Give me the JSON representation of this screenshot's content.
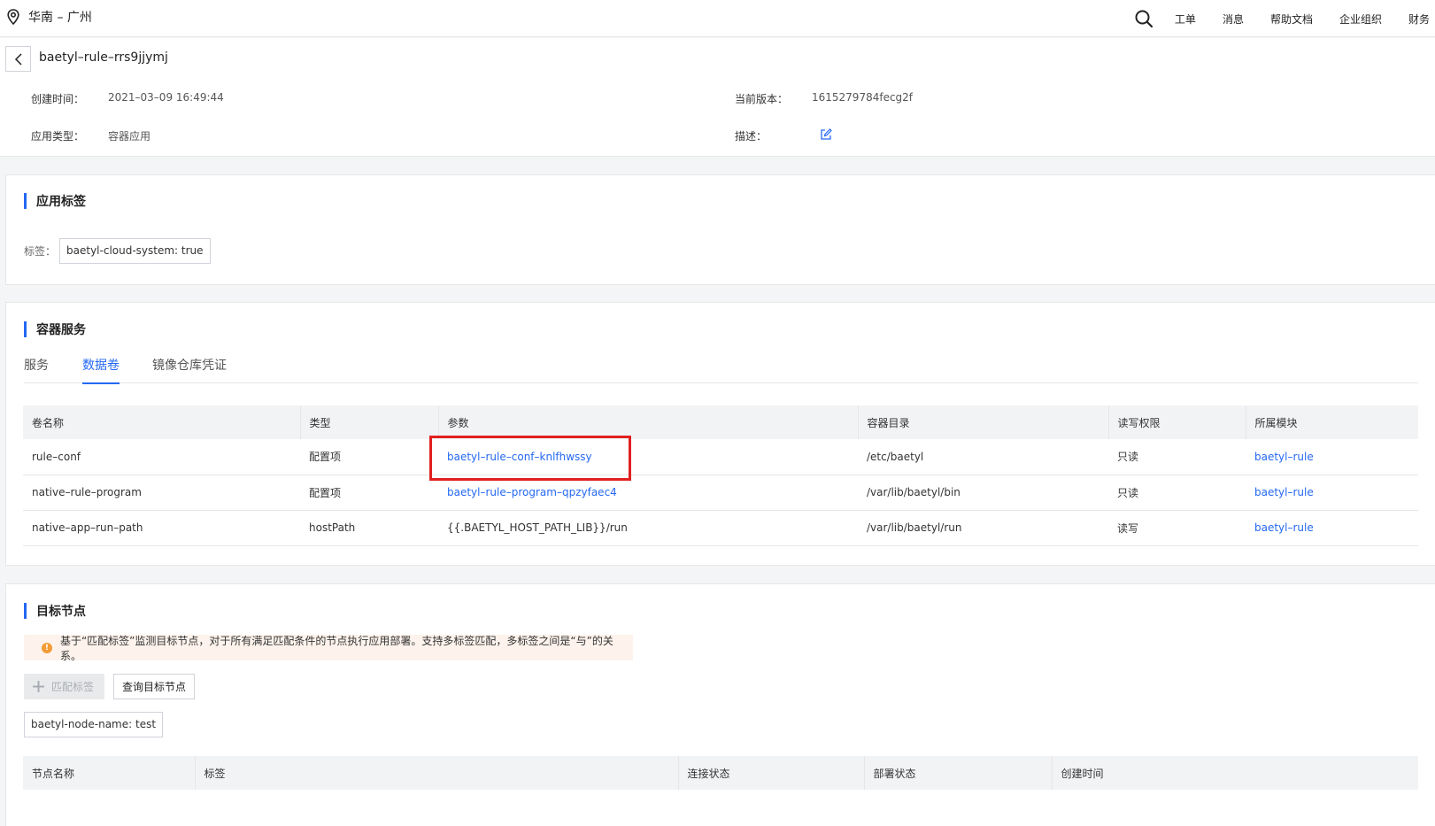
{
  "topbar": {
    "region": "华南 – 广州",
    "nav": [
      "工单",
      "消息",
      "帮助文档",
      "企业组织",
      "财务"
    ]
  },
  "header": {
    "title": "baetyl–rule–rrs9jjymj",
    "created_label": "创建时间：",
    "created_value": "2021–03–09 16:49:44",
    "version_label": "当前版本：",
    "version_value": "1615279784fecg2f",
    "type_label": "应用类型：",
    "type_value": "容器应用",
    "desc_label": "描述："
  },
  "labels_section": {
    "title": "应用标签",
    "tag_label": "标签：",
    "tag": "baetyl-cloud-system: true"
  },
  "container_section": {
    "title": "容器服务",
    "tabs": [
      "服务",
      "数据卷",
      "镜像仓库凭证"
    ],
    "active_tab": "数据卷",
    "columns": [
      "卷名称",
      "类型",
      "参数",
      "容器目录",
      "读写权限",
      "所属模块"
    ],
    "rows": [
      {
        "name": "rule–conf",
        "type": "配置项",
        "param": "baetyl–rule–conf–knlfhwssy",
        "dir": "/etc/baetyl",
        "perm": "只读",
        "module": "baetyl–rule"
      },
      {
        "name": "native–rule–program",
        "type": "配置项",
        "param": "baetyl–rule–program–qpzyfaec4",
        "dir": "/var/lib/baetyl/bin",
        "perm": "只读",
        "module": "baetyl–rule"
      },
      {
        "name": "native–app–run–path",
        "type": "hostPath",
        "param": "{{.BAETYL_HOST_PATH_LIB}}/run",
        "dir": "/var/lib/baetyl/run",
        "perm": "读写",
        "module": "baetyl–rule"
      }
    ]
  },
  "target_section": {
    "title": "目标节点",
    "notice": "基于“匹配标签”监测目标节点，对于所有满足匹配条件的节点执行应用部署。支持多标签匹配，多标签之间是“与”的关系。",
    "match_button": "匹配标签",
    "query_button": "查询目标节点",
    "node_tag": "baetyl-node-name: test",
    "columns": [
      "节点名称",
      "标签",
      "连接状态",
      "部署状态",
      "创建时间"
    ]
  },
  "colors": {
    "accent": "#2468f2",
    "highlight": "#e02020",
    "warning": "#f39c34"
  },
  "icons": [
    "location-pin-icon",
    "search-icon",
    "back-arrow-icon",
    "edit-icon",
    "warning-icon",
    "plus-icon"
  ]
}
